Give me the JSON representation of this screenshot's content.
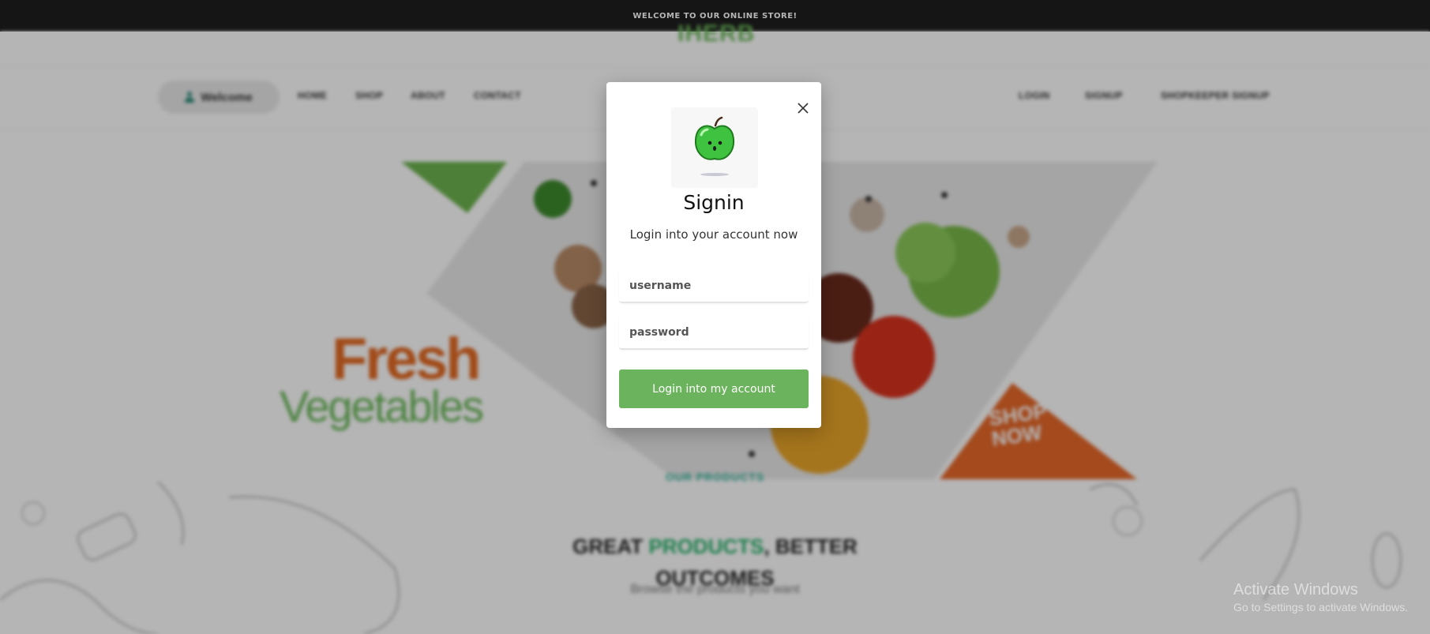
{
  "topbar": {
    "text": "WELCOME TO OUR ONLINE STORE!"
  },
  "header": {
    "logo": "IHERB"
  },
  "nav": {
    "welcome_label": "Welcome",
    "left_links": [
      "HOME",
      "SHOP",
      "ABOUT",
      "CONTACT"
    ],
    "right_links": [
      "LOGIN",
      "SIGNUP",
      "SHOPKEEPER SIGNUP"
    ]
  },
  "hero": {
    "headline_1": "Fresh",
    "headline_2": "Vegetables",
    "cta_line_1": "SHOP",
    "cta_line_2": "NOW"
  },
  "products_section": {
    "eyebrow": "OUR PRODUCTS",
    "title_part_1": "GREAT ",
    "title_highlight": "PRODUCTS",
    "title_part_2": ", BETTER",
    "title_line_2": "OUTCOMES",
    "subtitle": "Browse the products you want"
  },
  "watermark": {
    "line_1": "Activate Windows",
    "line_2": "Go to Settings to activate Windows."
  },
  "modal": {
    "title": "Signin",
    "subtitle": "Login into your account now",
    "username_placeholder": "username",
    "password_placeholder": "password",
    "submit_label": "Login into my account",
    "icons": {
      "close": "close-icon",
      "logo": "apple-icon"
    }
  },
  "colors": {
    "brand_green": "#6cb35d",
    "accent_orange": "#e46a23",
    "teal": "#2fb59c",
    "topbar_bg": "#1e1e1e"
  }
}
